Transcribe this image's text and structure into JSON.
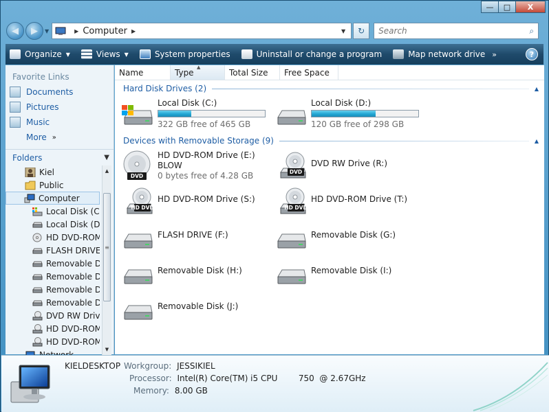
{
  "window": {
    "caption": {
      "minimize": "—",
      "maximize": "□",
      "close": "X"
    }
  },
  "nav": {
    "back": "◀",
    "forward": "▶",
    "dropdown": "▼",
    "address": {
      "crumb": "Computer",
      "refresh": "↻"
    },
    "search": {
      "placeholder": "Search"
    }
  },
  "toolbar": {
    "organize": "Organize",
    "views": "Views",
    "system_properties": "System properties",
    "uninstall": "Uninstall or change a program",
    "map_drive": "Map network drive",
    "more": "»",
    "help": "?"
  },
  "sidebar": {
    "favorites_title": "Favorite Links",
    "favorites": [
      "Documents",
      "Pictures",
      "Music",
      "More"
    ],
    "folders_title": "Folders",
    "tree": [
      {
        "label": "Kiel",
        "icon": "user-icon",
        "indent": 1
      },
      {
        "label": "Public",
        "icon": "folder-icon",
        "indent": 1
      },
      {
        "label": "Computer",
        "icon": "computer-icon",
        "indent": 1,
        "selected": true
      },
      {
        "label": "Local Disk (C:)",
        "icon": "windows-drive-icon",
        "indent": 2
      },
      {
        "label": "Local Disk (D:)",
        "icon": "hard-drive-icon",
        "indent": 2
      },
      {
        "label": "HD DVD-ROM",
        "icon": "disc-icon",
        "indent": 2
      },
      {
        "label": "FLASH DRIVE (",
        "icon": "removable-drive-icon",
        "indent": 2
      },
      {
        "label": "Removable Dis",
        "icon": "removable-drive-icon",
        "indent": 2
      },
      {
        "label": "Removable Dis",
        "icon": "removable-drive-icon",
        "indent": 2
      },
      {
        "label": "Removable Dis",
        "icon": "removable-drive-icon",
        "indent": 2
      },
      {
        "label": "Removable Dis",
        "icon": "removable-drive-icon",
        "indent": 2
      },
      {
        "label": "DVD RW Drive",
        "icon": "dvd-drive-icon",
        "indent": 2
      },
      {
        "label": "HD DVD-ROM",
        "icon": "hddvd-drive-icon",
        "indent": 2
      },
      {
        "label": "HD DVD-ROM",
        "icon": "hddvd-drive-icon",
        "indent": 2
      },
      {
        "label": "Network",
        "icon": "network-icon",
        "indent": 1
      }
    ]
  },
  "columns": [
    "Name",
    "Type",
    "Total Size",
    "Free Space"
  ],
  "groups": {
    "hard_disks": "Hard Disk Drives (2)",
    "removable": "Devices with Removable Storage (9)"
  },
  "hard_disks": [
    {
      "name": "Local Disk (C:)",
      "free": "322 GB free of 465 GB",
      "used_fraction": 0.31
    },
    {
      "name": "Local Disk (D:)",
      "free": "120 GB free of 298 GB",
      "used_fraction": 0.6
    }
  ],
  "removable": [
    {
      "name": "HD DVD-ROM Drive (E:)",
      "line2": "BLOW",
      "sub": "0 bytes free of 4.28 GB",
      "icon": "disc-icon"
    },
    {
      "name": "DVD RW Drive (R:)",
      "icon": "dvd-drive-icon"
    },
    {
      "name": "HD DVD-ROM Drive (S:)",
      "icon": "hddvd-drive-icon"
    },
    {
      "name": "HD DVD-ROM Drive (T:)",
      "icon": "hddvd-drive-icon"
    },
    {
      "name": "FLASH DRIVE (F:)",
      "icon": "removable-drive-icon"
    },
    {
      "name": "Removable Disk (G:)",
      "icon": "removable-drive-icon"
    },
    {
      "name": "Removable Disk (H:)",
      "icon": "removable-drive-icon"
    },
    {
      "name": "Removable Disk (I:)",
      "icon": "removable-drive-icon"
    },
    {
      "name": "Removable Disk (J:)",
      "icon": "removable-drive-icon"
    }
  ],
  "details": {
    "computer_name": "KIELDESKTOP",
    "workgroup_label": "Workgroup:",
    "workgroup": "JESSIKIEL",
    "processor_label": "Processor:",
    "processor": "Intel(R) Core(TM) i5 CPU        750  @ 2.67GHz",
    "memory_label": "Memory:",
    "memory": "8.00 GB"
  }
}
